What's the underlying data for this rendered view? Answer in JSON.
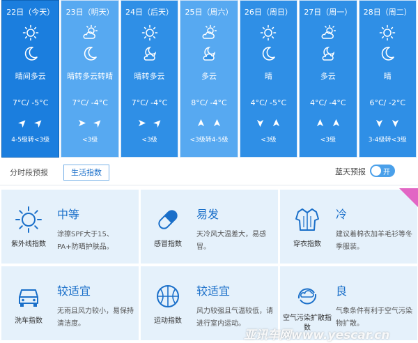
{
  "forecast": [
    {
      "date": "22日（今天）",
      "day_icon": "sun-icon",
      "night_icon": "moon-icon",
      "desc": "晴间多云",
      "temp": "7°C/ -5°C",
      "wind": [
        "ne",
        "ne"
      ],
      "level": "4-5级转<3级",
      "style": "sel"
    },
    {
      "date": "23日（明天）",
      "day_icon": "sun-cloud-icon",
      "night_icon": "moon-icon",
      "desc": "晴转多云转晴",
      "temp": "7°C/ -4°C",
      "wind": [
        "e",
        "ne"
      ],
      "level": "<3级",
      "style": "light"
    },
    {
      "date": "24日（后天）",
      "day_icon": "sun-icon",
      "night_icon": "moon-cloud-icon",
      "desc": "晴转多云",
      "temp": "7°C/ -4°C",
      "wind": [
        "e",
        "ne"
      ],
      "level": "<3级",
      "style": "mid"
    },
    {
      "date": "25日（周六）",
      "day_icon": "sun-cloud-icon",
      "night_icon": "moon-cloud-icon",
      "desc": "多云",
      "temp": "8°C/ -4°C",
      "wind": [
        "n",
        "n"
      ],
      "level": "<3级转4-5级",
      "style": "light"
    },
    {
      "date": "26日（周日）",
      "day_icon": "sun-icon",
      "night_icon": "moon-icon",
      "desc": "晴",
      "temp": "4°C/ -5°C",
      "wind": [
        "s",
        "n"
      ],
      "level": "<3级",
      "style": "mid"
    },
    {
      "date": "27日（周一）",
      "day_icon": "sun-cloud-icon",
      "night_icon": "moon-cloud-icon",
      "desc": "多云",
      "temp": "4°C/ -4°C",
      "wind": [
        "n",
        "n"
      ],
      "level": "<3级",
      "style": "mid"
    },
    {
      "date": "28日（周二）",
      "day_icon": "sun-icon",
      "night_icon": "moon-icon",
      "desc": "晴",
      "temp": "6°C/ -2°C",
      "wind": [
        "s",
        "s"
      ],
      "level": "3-4级转<3级",
      "style": "mid"
    }
  ],
  "tabs": {
    "hourly": "分时段预报",
    "life": "生活指数"
  },
  "bluesky": {
    "label": "蓝天预报",
    "toggle": "开"
  },
  "life_index": [
    {
      "icon": "sun-icon",
      "name": "紫外线指数",
      "level": "中等",
      "text": "涂擦SPF大于15、PA+防晒护肤品。"
    },
    {
      "icon": "pill-icon",
      "name": "感冒指数",
      "level": "易发",
      "text": "天冷风大温差大，易感冒。"
    },
    {
      "icon": "shirt-icon",
      "name": "穿衣指数",
      "level": "冷",
      "text": "建议着棉衣加羊毛衫等冬季服装。"
    },
    {
      "icon": "car-icon",
      "name": "洗车指数",
      "level": "较适宜",
      "text": "无雨且风力较小，易保持清洁度。"
    },
    {
      "icon": "ball-icon",
      "name": "运动指数",
      "level": "较适宜",
      "text": "风力较强且气温较低，请进行室内运动。"
    },
    {
      "icon": "air-icon",
      "name": "空气污染扩散指数",
      "level": "良",
      "text": "气象条件有利于空气污染物扩散。"
    }
  ],
  "watermark": "亚讯车网www.yescar.cn",
  "colors": {
    "accent": "#1a6fc9",
    "day_bg": "#2f8fe6",
    "day_bg_light": "#57a9f1",
    "card_bg": "#e5f1fb",
    "corner": "#e266c4"
  }
}
